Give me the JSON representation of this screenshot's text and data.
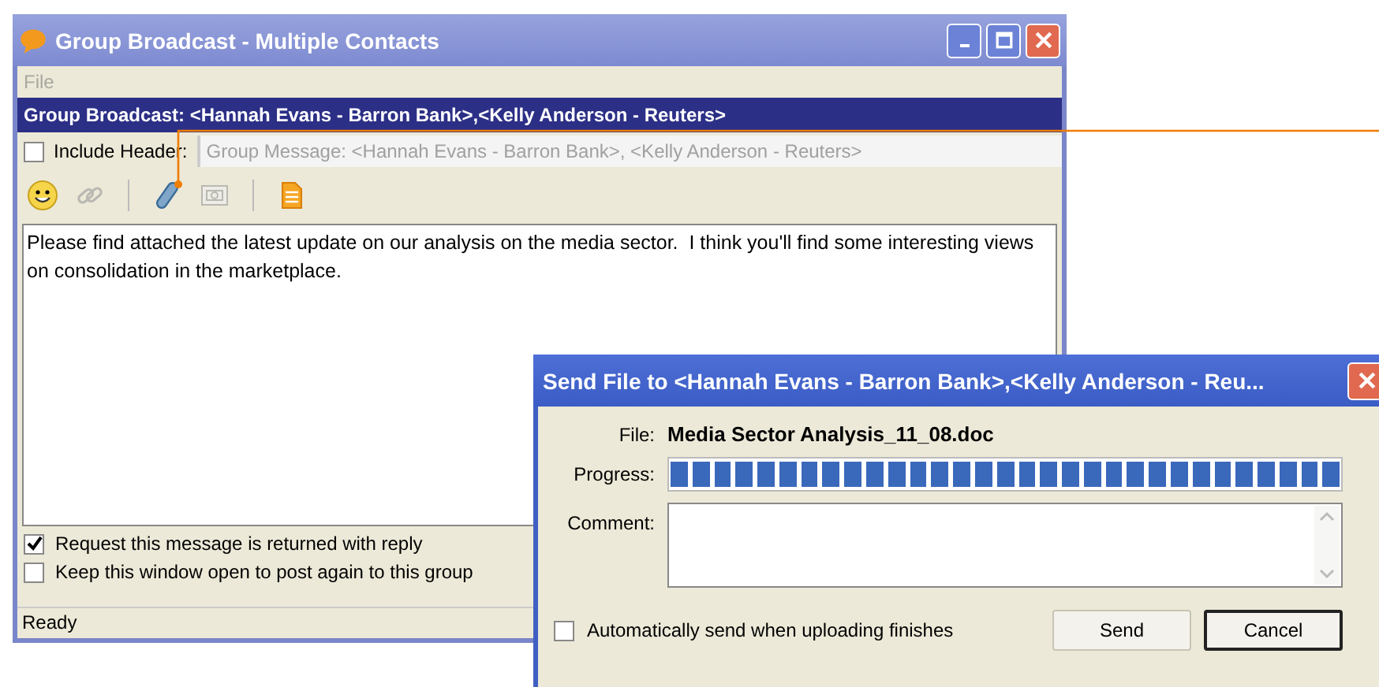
{
  "window": {
    "title": "Group Broadcast - Multiple Contacts"
  },
  "menu": [
    {
      "label": "File",
      "disabled": true
    }
  ],
  "header": "Group Broadcast: <Hannah Evans - Barron Bank>,<Kelly Anderson - Reuters>",
  "include_header": {
    "label": "Include Header:",
    "checked": false,
    "value": "Group Message: <Hannah Evans - Barron Bank>, <Kelly Anderson - Reuters>",
    "disabled": true
  },
  "toolbar": [
    {
      "kind": "smiley",
      "disabled": false
    },
    {
      "kind": "clip",
      "disabled": true
    },
    {
      "kind": "sep"
    },
    {
      "kind": "attach",
      "disabled": false
    },
    {
      "kind": "picture",
      "disabled": true
    },
    {
      "kind": "sep"
    },
    {
      "kind": "doc",
      "disabled": false
    }
  ],
  "message": "Please find attached the latest update on our analysis on the media sector.  I think you'll find some interesting views on consolidation in the marketplace.",
  "options": [
    {
      "label": "Request this message is returned with reply",
      "checked": true
    },
    {
      "label": "Keep this window open to post again to this group",
      "checked": false
    }
  ],
  "status_bar": "Ready",
  "dialog": {
    "title": "Send File to <Hannah Evans - Barron Bank>,<Kelly Anderson - Reu...",
    "file_label": "File:",
    "file": "Media Sector Analysis_11_08.doc",
    "progress_label": "Progress:",
    "progress": {
      "level": 1
    },
    "comment_label": "Comment:",
    "auto_send": {
      "label": "Automatically send when uploading finishes",
      "checked": false
    },
    "buttons": [
      {
        "label": "Send",
        "default": false
      },
      {
        "label": "Cancel",
        "default": true
      }
    ]
  }
}
